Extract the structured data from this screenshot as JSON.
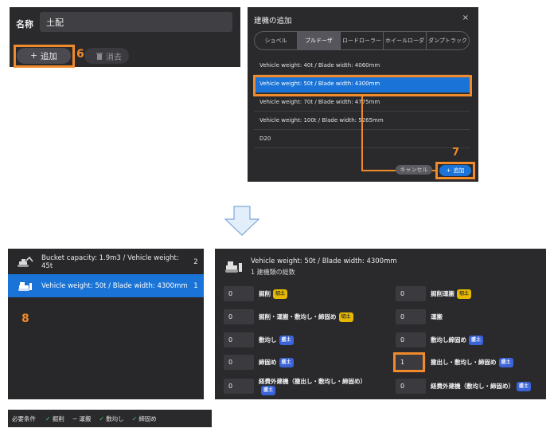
{
  "form": {
    "name_label": "名称",
    "name_value": "土配",
    "add_label": "追加",
    "delete_label": "消去",
    "step_number": "6"
  },
  "dialog": {
    "title": "建機の追加",
    "close_symbol": "×",
    "tabs": [
      {
        "label": "ショベル",
        "selected": false
      },
      {
        "label": "ブルドーザ",
        "selected": true
      },
      {
        "label": "ロードローラー",
        "selected": false
      },
      {
        "label": "ホイールローダ",
        "selected": false
      },
      {
        "label": "ダンプトラック",
        "selected": false
      }
    ],
    "items": [
      {
        "label": "Vehicle weight: 40t / Blade width: 4060mm",
        "selected": false
      },
      {
        "label": "Vehicle weight: 50t / Blade width: 4300mm",
        "selected": true
      },
      {
        "label": "Vehicle weight: 70t / Blade width: 4775mm",
        "selected": false
      },
      {
        "label": "Vehicle weight: 100t / Blade width: 5265mm",
        "selected": false
      },
      {
        "label": "D20",
        "selected": false
      }
    ],
    "cancel_label": "キャンセル",
    "add_label": "追加",
    "step_number": "7"
  },
  "machines": {
    "rows": [
      {
        "label": "Bucket capacity: 1.9m3 / Vehicle weight: 45t",
        "count": "2",
        "icon": "excavator-icon",
        "selected": false
      },
      {
        "label": "Vehicle weight: 50t / Blade width: 4300mm",
        "count": "1",
        "icon": "bulldozer-icon",
        "selected": true
      }
    ],
    "step_number": "8"
  },
  "detail": {
    "title": "Vehicle weight: 50t / Blade width: 4300mm",
    "subtitle": "1 建機類の総数",
    "left_fields": [
      {
        "value": "0",
        "label": "掘削",
        "badge": "切土",
        "badge_type": "cut"
      },
      {
        "value": "0",
        "label": "掘削・運搬・敷均し・締固め",
        "badge": "切土",
        "badge_type": "cut"
      },
      {
        "value": "0",
        "label": "敷均し",
        "badge": "盛土",
        "badge_type": "fill"
      },
      {
        "value": "0",
        "label": "締固め",
        "badge": "盛土",
        "badge_type": "fill"
      },
      {
        "value": "0",
        "label": "経費外建機（撒出し・敷均し・締固め）",
        "badge": "盛土",
        "badge_type": "fill"
      }
    ],
    "right_fields": [
      {
        "value": "0",
        "label": "掘削運搬",
        "badge": "切土",
        "badge_type": "cut"
      },
      {
        "value": "0",
        "label": "運搬",
        "badge": "",
        "badge_type": ""
      },
      {
        "value": "0",
        "label": "敷均し締固め",
        "badge": "盛土",
        "badge_type": "fill"
      },
      {
        "value": "1",
        "label": "撒出し・敷均し・締固め",
        "badge": "盛土",
        "badge_type": "fill"
      },
      {
        "value": "0",
        "label": "経費外建機（敷均し・締固め）",
        "badge": "盛土",
        "badge_type": "fill"
      }
    ]
  },
  "requirements": {
    "label": "必要条件",
    "items": [
      {
        "label": "掘削",
        "met": true
      },
      {
        "label": "運搬",
        "met": false
      },
      {
        "label": "敷均し",
        "met": true
      },
      {
        "label": "締固め",
        "met": true
      }
    ]
  },
  "colors": {
    "highlight": "#f08a2a",
    "accent": "#1a73d6",
    "panel": "#2a2a2d",
    "badge_cut": "#e6b800",
    "badge_fill": "#3b64d9",
    "check": "#46c35a"
  }
}
